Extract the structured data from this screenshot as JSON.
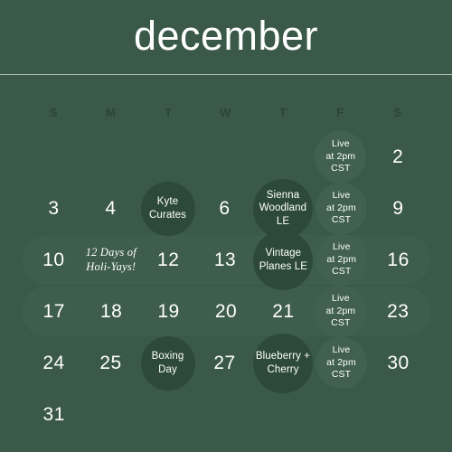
{
  "header": {
    "month_title": "december"
  },
  "colors": {
    "background": "#3a5949",
    "band": "#3e5d4c",
    "badge_dark": "#2d4a38",
    "badge_light": "#41604f",
    "text": "#ffffff",
    "weekday_text": "#2c4536",
    "rule": "#cdd8d1"
  },
  "weekdays": [
    {
      "label": "S"
    },
    {
      "label": "M"
    },
    {
      "label": "T"
    },
    {
      "label": "W"
    },
    {
      "label": "T"
    },
    {
      "label": "F"
    },
    {
      "label": "S"
    }
  ],
  "weeks": [
    {
      "banded": false,
      "cells": [
        {
          "type": "empty",
          "text": ""
        },
        {
          "type": "empty",
          "text": ""
        },
        {
          "type": "empty",
          "text": ""
        },
        {
          "type": "empty",
          "text": ""
        },
        {
          "type": "empty",
          "text": ""
        },
        {
          "type": "badge-light",
          "text": "Live\nat 2pm\nCST"
        },
        {
          "type": "day",
          "text": "2"
        }
      ]
    },
    {
      "banded": false,
      "cells": [
        {
          "type": "day",
          "text": "3"
        },
        {
          "type": "day",
          "text": "4"
        },
        {
          "type": "badge-dark",
          "text": "Kyte\nCurates"
        },
        {
          "type": "day",
          "text": "6"
        },
        {
          "type": "badge-dark-wide",
          "text": "Sienna\nWoodland\nLE"
        },
        {
          "type": "badge-light",
          "text": "Live\nat 2pm\nCST"
        },
        {
          "type": "day",
          "text": "9"
        }
      ]
    },
    {
      "banded": true,
      "cells": [
        {
          "type": "day",
          "text": "10"
        },
        {
          "type": "badge-script",
          "text": "12 Days of\nHoli-Yays!"
        },
        {
          "type": "day",
          "text": "12"
        },
        {
          "type": "day",
          "text": "13"
        },
        {
          "type": "badge-dark-wide",
          "text": "Vintage\nPlanes LE"
        },
        {
          "type": "badge-light",
          "text": "Live\nat 2pm\nCST"
        },
        {
          "type": "day",
          "text": "16"
        }
      ]
    },
    {
      "banded": true,
      "cells": [
        {
          "type": "day",
          "text": "17"
        },
        {
          "type": "day",
          "text": "18"
        },
        {
          "type": "day",
          "text": "19"
        },
        {
          "type": "day",
          "text": "20"
        },
        {
          "type": "day",
          "text": "21"
        },
        {
          "type": "badge-light",
          "text": "Live\nat 2pm\nCST"
        },
        {
          "type": "day",
          "text": "23"
        }
      ]
    },
    {
      "banded": false,
      "cells": [
        {
          "type": "day",
          "text": "24"
        },
        {
          "type": "day",
          "text": "25"
        },
        {
          "type": "badge-dark",
          "text": "Boxing\nDay"
        },
        {
          "type": "day",
          "text": "27"
        },
        {
          "type": "badge-dark-wide",
          "text": "Blueberry +\nCherry"
        },
        {
          "type": "badge-light",
          "text": "Live\nat 2pm\nCST"
        },
        {
          "type": "day",
          "text": "30"
        }
      ]
    },
    {
      "banded": false,
      "cells": [
        {
          "type": "day",
          "text": "31"
        },
        {
          "type": "empty",
          "text": ""
        },
        {
          "type": "empty",
          "text": ""
        },
        {
          "type": "empty",
          "text": ""
        },
        {
          "type": "empty",
          "text": ""
        },
        {
          "type": "empty",
          "text": ""
        },
        {
          "type": "empty",
          "text": ""
        }
      ]
    }
  ]
}
